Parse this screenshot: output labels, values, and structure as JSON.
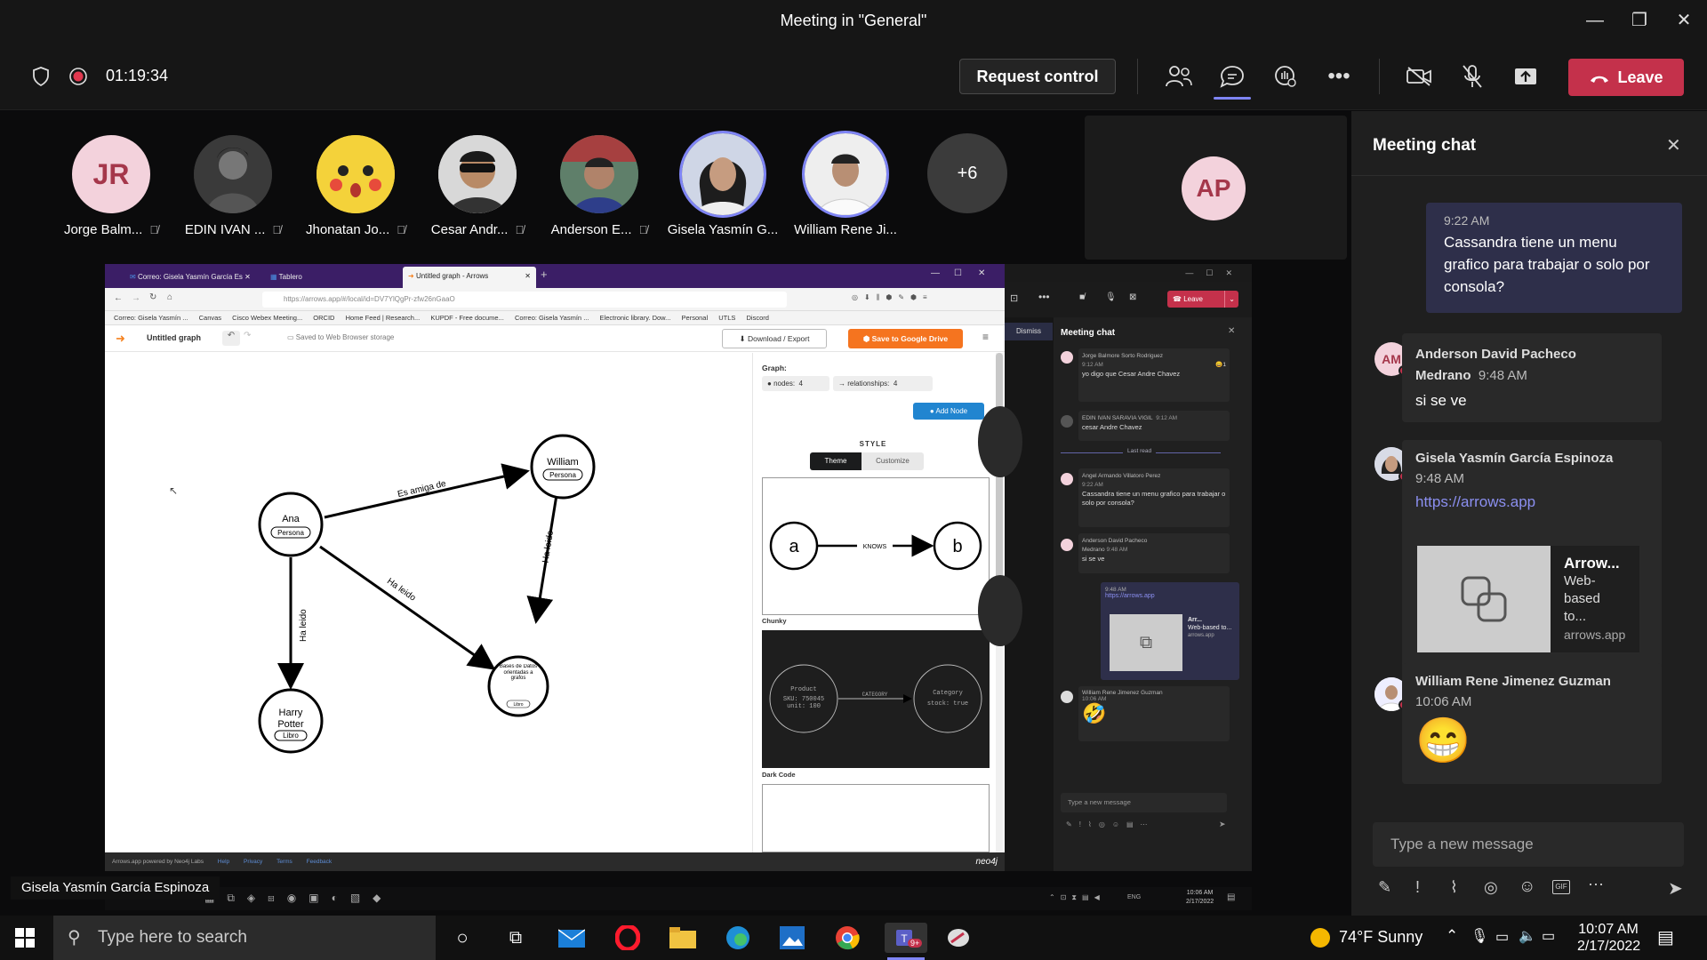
{
  "window": {
    "title": "Meeting in \"General\"",
    "min": "—",
    "max": "❐",
    "close": "✕"
  },
  "meeting": {
    "timer": "01:19:34",
    "request_control": "Request control",
    "leave": "Leave",
    "accent": "#c4314b"
  },
  "participants": [
    {
      "name": "Jorge Balm...",
      "initials": "JR"
    },
    {
      "name": "EDIN IVAN ...",
      "initials": ""
    },
    {
      "name": "Jhonatan Jo...",
      "initials": ""
    },
    {
      "name": "Cesar Andr...",
      "initials": ""
    },
    {
      "name": "Anderson E...",
      "initials": ""
    },
    {
      "name": "Gisela Yasmín G...",
      "initials": ""
    },
    {
      "name": "William Rene Ji...",
      "initials": ""
    }
  ],
  "overflow": "+6",
  "self_avatar": "AP",
  "presenter_label": "Gisela Yasmín García Espinoza",
  "browser": {
    "tabs": [
      "Correo: Gisela Yasmín García Es",
      "Tablero",
      "Untitled graph - Arrows"
    ],
    "url": "https://arrows.app/#/local/id=DV7YlQgPr-zfw26nGaaO",
    "bookmarks": [
      "Correo: Gisela Yasmín ...",
      "Canvas",
      "Cisco Webex Meeting...",
      "ORCID",
      "Home Feed | Research...",
      "KUPDF - Free docume...",
      "Correo: Gisela Yasmín ...",
      "Electronic library. Dow...",
      "Personal",
      "UTLS",
      "Discord"
    ]
  },
  "arrows": {
    "doc_title": "Untitled graph",
    "saved": "Saved to Web Browser storage",
    "download": "Download / Export",
    "save_drive": "Save to Google Drive",
    "graph_label": "Graph:",
    "nodes_label": "nodes:",
    "nodes_count": "4",
    "rels_label": "relationships:",
    "rels_count": "4",
    "add_node": "Add Node",
    "style_label": "STYLE",
    "theme_tab": "Theme",
    "customize_tab": "Customize",
    "theme1_a": "a",
    "theme1_b": "b",
    "theme1_rel": "KNOWS",
    "theme1_name": "Chunky",
    "theme2_n1": "Product",
    "theme2_n1b": "SKU: 750045",
    "theme2_n1c": "unit: 100",
    "theme2_rel": "CATEGORY",
    "theme2_n2": "Category",
    "theme2_n2b": "stock: true",
    "theme2_name": "Dark Code",
    "footer": [
      "Arrows.app powered by Neo4j Labs",
      "Help",
      "Privacy",
      "Terms",
      "Feedback"
    ],
    "footer_logo": "neo4j",
    "graph": {
      "ana": "Ana",
      "ana_label": "Persona",
      "william": "William",
      "william_label": "Persona",
      "harry1": "Harry",
      "harry2": "Potter",
      "harry_label": "Libro",
      "db": "Bases de Datos orientadas a grafos",
      "db_label": "Libro",
      "rel_amiga": "Es amiga de",
      "rel_leido1": "Ha leido",
      "rel_leido2": "Ha leido",
      "rel_leido3": "Ha leido"
    }
  },
  "inner_teams": {
    "dismiss": "Dismiss",
    "leave": "Leave",
    "chat_title": "Meeting chat",
    "msgs": [
      {
        "name": "Jorge Balmore Sorto Rodriguez",
        "time": "9:12 AM",
        "text": "yo digo que Cesar Andre Chavez",
        "reaction": "1"
      },
      {
        "name": "EDIN IVAN SARAVIA VIGIL",
        "time": "9:12 AM",
        "text": "cesar Andre Chavez"
      },
      {
        "name": "Angel Armando Villatoro Perez",
        "time": "9:22 AM",
        "text": "Cassandra tiene un menu grafico para trabajar o solo por consola?"
      },
      {
        "name": "Anderson David Pacheco Medrano",
        "time": "9:48 AM",
        "text": "si se ve"
      },
      {
        "name": "William Rene Jimenez Guzman",
        "time": "10:06 AM",
        "text": ""
      }
    ],
    "last_read": "Last read",
    "link_time": "9:48 AM",
    "link": "https://arrows.app",
    "link_title": "Arr...",
    "link_desc": "Web-based to...",
    "link_site": "arrows.app",
    "compose": "Type a new message",
    "clock_time": "10:06 AM",
    "clock_date": "2/17/2022",
    "lang": "ENG"
  },
  "chat": {
    "title": "Meeting chat",
    "mine": {
      "time": "9:22 AM",
      "text": "Cassandra tiene un menu grafico para trabajar o solo por consola?"
    },
    "messages": [
      {
        "initials": "AM",
        "name": "Anderson David Pacheco Medrano",
        "time": "9:48 AM",
        "text": "si se ve"
      },
      {
        "name": "Gisela Yasmín García Espinoza",
        "time": "9:48 AM",
        "link": "https://arrows.app",
        "card_title": "Arrow...",
        "card_desc": "Web-based to...",
        "card_site": "arrows.app"
      },
      {
        "name": "William Rene Jimenez Guzman",
        "time": "10:06 AM",
        "emoji": "😁"
      }
    ],
    "compose_placeholder": "Type a new message"
  },
  "taskbar": {
    "search": "Type here to search",
    "weather": "74°F  Sunny",
    "time": "10:07 AM",
    "date": "2/17/2022",
    "teams_badge": "9+"
  }
}
